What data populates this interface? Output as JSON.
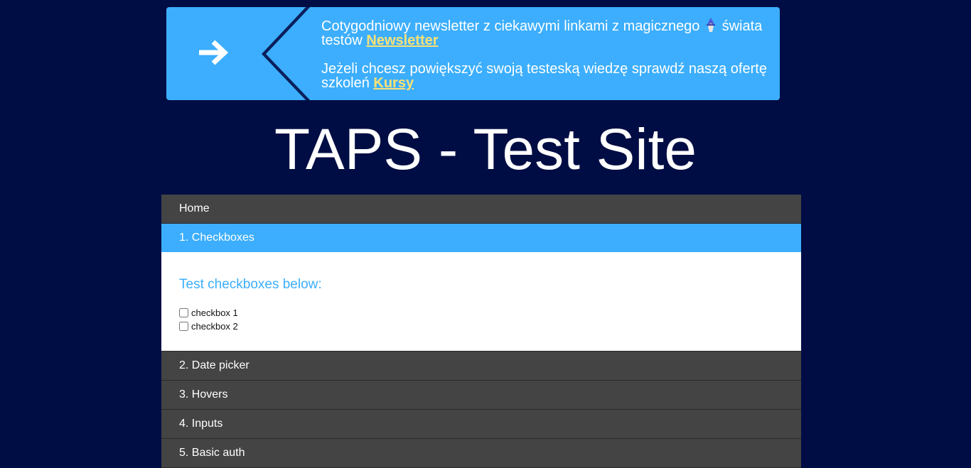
{
  "banner": {
    "newsletter_text_before": "Cotygodniowy newsletter z ciekawymi linkami z magicznego",
    "newsletter_text_after": "świata testów",
    "newsletter_link": "Newsletter",
    "courses_text": "Jeżeli chcesz powiększyć swoją testeską wiedzę sprawdź naszą ofertę szkoleń",
    "courses_link": "Kursy",
    "arrow_icon": "arrow-right-icon",
    "emoji_icon": "wizard-icon",
    "background_color": "#3caefd",
    "link_color": "#f9e175"
  },
  "site": {
    "title": "TAPS - Test Site",
    "background_color": "#000d44"
  },
  "menu": {
    "home": "Home",
    "active_section": "1. Checkboxes",
    "panel_heading": "Test checkboxes below:",
    "checkboxes": [
      {
        "label": "checkbox 1",
        "checked": false
      },
      {
        "label": "checkbox 2",
        "checked": false
      }
    ],
    "sections_after": [
      "2. Date picker",
      "3. Hovers",
      "4. Inputs",
      "5. Basic auth"
    ],
    "header_color": "#444444",
    "active_color": "#3caefd"
  }
}
